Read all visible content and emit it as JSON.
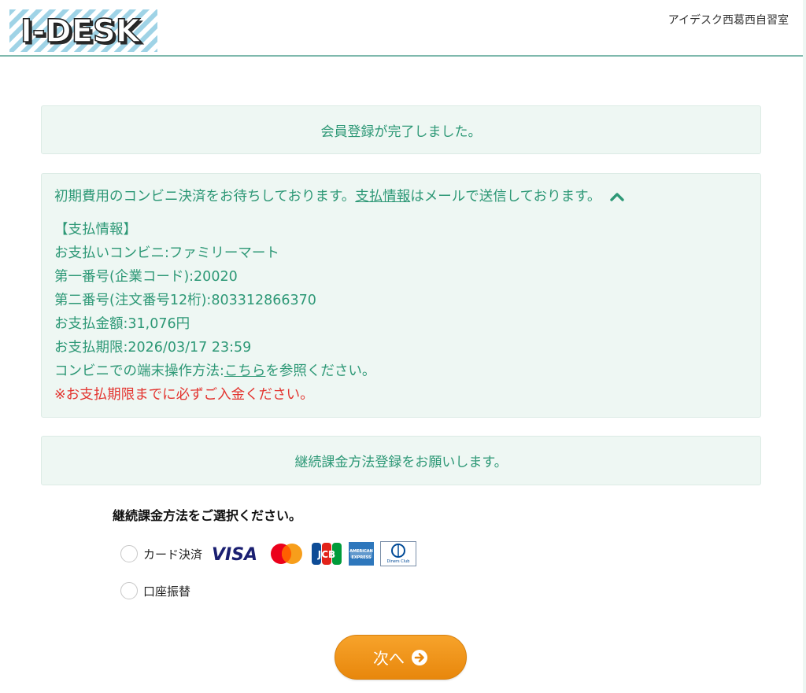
{
  "header": {
    "logo_text": "I-DESK",
    "site_name": "アイデスク西葛西自習室"
  },
  "messages": {
    "registration_complete": "会員登録が完了しました。",
    "recurring_request": "継続課金方法登録をお願いします。"
  },
  "payment_info": {
    "header_prefix": "初期費用のコンビニ決済をお待ちしております。",
    "header_link": "支払情報",
    "header_suffix": "はメールで送信しております。",
    "section_title": "【支払情報】",
    "store": "お支払いコンビニ:ファミリーマート",
    "first_number": "第一番号(企業コード):20020",
    "second_number": "第二番号(注文番号12桁):803312866370",
    "amount": "お支払金額:31,076円",
    "deadline": "お支払期限:2026/03/17 23:59",
    "operation_prefix": "コンビニでの端末操作方法:",
    "operation_link": "こちら",
    "operation_suffix": "を参照ください。",
    "warning": "※お支払期限までに必ずご入金ください。"
  },
  "selection": {
    "title": "継続課金方法をご選択ください。",
    "options": [
      {
        "label": "カード決済",
        "selected": false,
        "brands": [
          "VISA",
          "Mastercard",
          "JCB",
          "AMERICAN EXPRESS",
          "Diners Club INTERNATIONAL"
        ]
      },
      {
        "label": "口座振替",
        "selected": false
      }
    ]
  },
  "next_button": {
    "label": "次へ",
    "icon": "arrow-circle-right-icon"
  },
  "colors": {
    "accent_green": "#2d9876",
    "panel_bg": "#eef7f3",
    "warning_red": "#e3342f",
    "button_orange": "#f39a1e"
  }
}
